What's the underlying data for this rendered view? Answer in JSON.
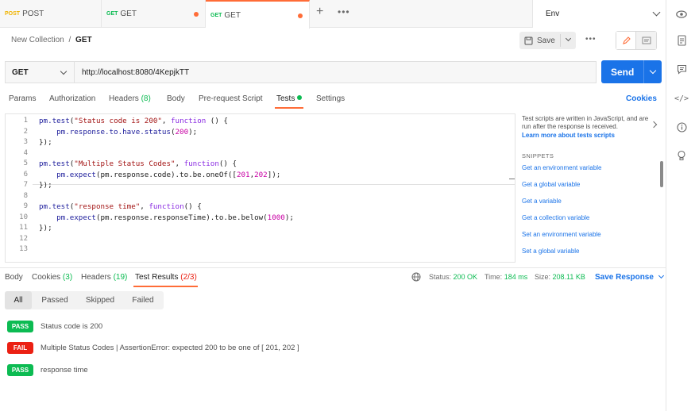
{
  "tabs": [
    {
      "method": "POST",
      "label": "POST",
      "unsaved": false
    },
    {
      "method": "GET",
      "label": "GET",
      "unsaved": true
    },
    {
      "method": "GET",
      "label": "GET",
      "unsaved": true
    }
  ],
  "environment": {
    "selected": "Env"
  },
  "breadcrumb": {
    "collection": "New Collection",
    "separator": "/",
    "request": "GET"
  },
  "toolbar": {
    "save_label": "Save",
    "more": "•••"
  },
  "request": {
    "method": "GET",
    "url": "http://localhost:8080/4KepjkTT",
    "send_label": "Send"
  },
  "request_tabs": {
    "params": "Params",
    "authorization": "Authorization",
    "headers": "Headers",
    "headers_count": "(8)",
    "body": "Body",
    "pre_request": "Pre-request Script",
    "tests": "Tests",
    "settings": "Settings",
    "cookies": "Cookies"
  },
  "editor": {
    "line_numbers": [
      "1",
      "2",
      "3",
      "4",
      "5",
      "6",
      "7",
      "8",
      "9",
      "10",
      "11",
      "12",
      "13"
    ]
  },
  "snippets": {
    "description": "Test scripts are written in JavaScript, and are run after the response is received.",
    "learn_more": "Learn more about tests scripts",
    "heading": "SNIPPETS",
    "items": [
      "Get an environment variable",
      "Get a global variable",
      "Get a variable",
      "Get a collection variable",
      "Set an environment variable",
      "Set a global variable"
    ]
  },
  "response_tabs": {
    "body": "Body",
    "cookies": "Cookies",
    "cookies_count": "(3)",
    "headers": "Headers",
    "headers_count": "(19)",
    "test_results": "Test Results",
    "test_results_count": "(2/3)"
  },
  "response_status": {
    "status_label": "Status:",
    "status_value": "200 OK",
    "time_label": "Time:",
    "time_value": "184 ms",
    "size_label": "Size:",
    "size_value": "208.11 KB",
    "save_response": "Save Response"
  },
  "filters": [
    "All",
    "Passed",
    "Skipped",
    "Failed"
  ],
  "results": [
    {
      "status": "PASS",
      "text": "Status code is 200"
    },
    {
      "status": "FAIL",
      "text": "Multiple Status Codes | AssertionError: expected 200 to be one of [ 201, 202 ]"
    },
    {
      "status": "PASS",
      "text": "response time"
    }
  ],
  "colors": {
    "accent": "#ff6c37",
    "primary": "#1a73e8",
    "pass": "#0cbb52",
    "fail": "#eb2013"
  }
}
